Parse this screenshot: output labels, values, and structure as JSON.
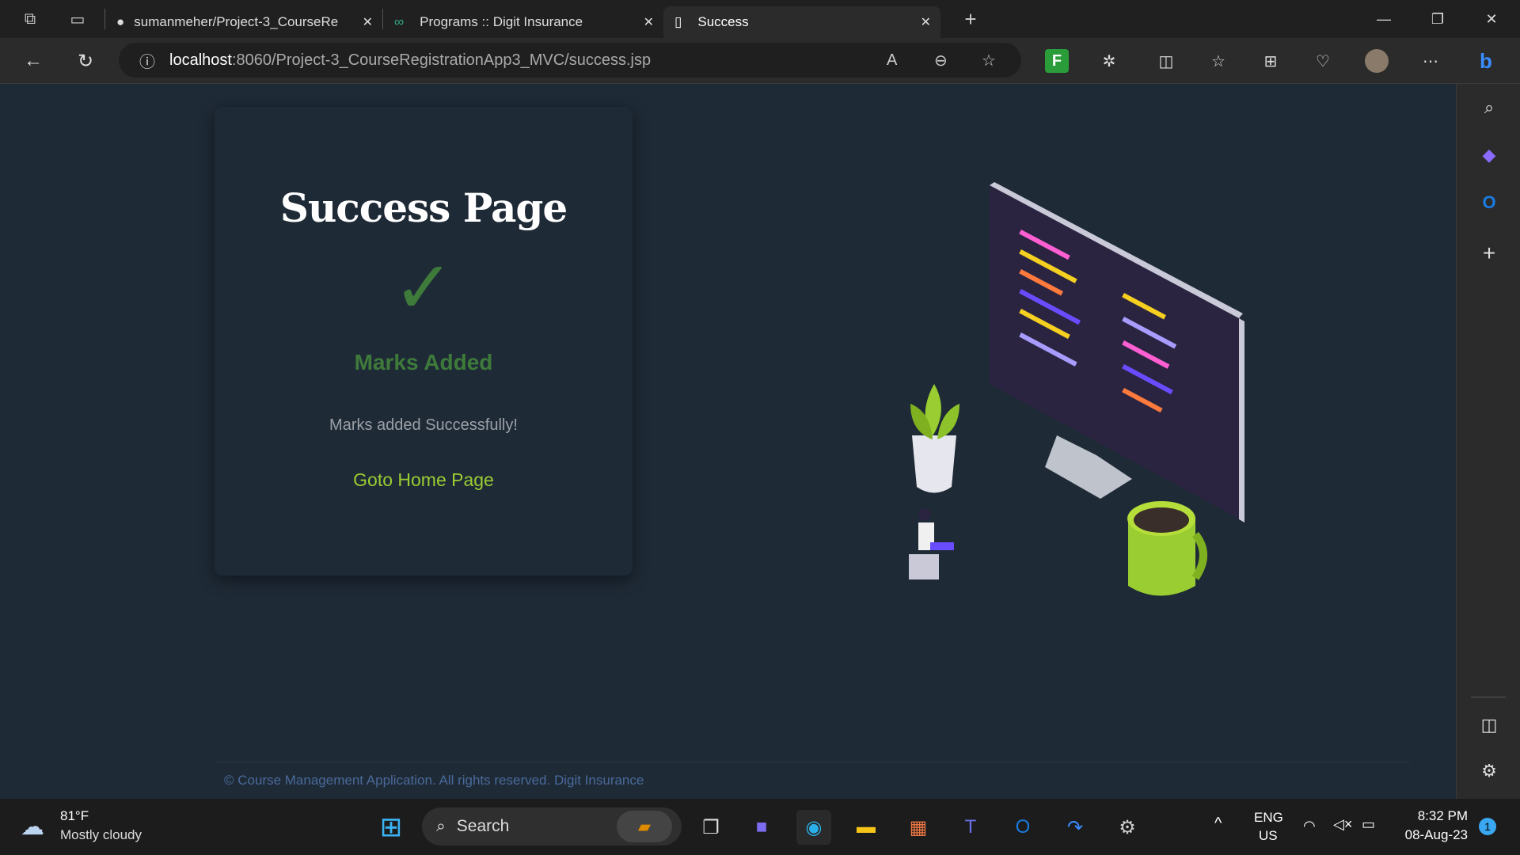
{
  "browser": {
    "tabs": [
      {
        "title": "sumanmeher/Project-3_CourseRe",
        "icon": "github-icon"
      },
      {
        "title": "Programs :: Digit Insurance",
        "icon": "link-icon"
      },
      {
        "title": "Success",
        "icon": "page-icon"
      }
    ],
    "url_host": "localhost",
    "url_path": ":8060/Project-3_CourseRegistrationApp3_MVC/success.jsp"
  },
  "card": {
    "title": "Success Page",
    "check": "✓",
    "status": "Marks Added",
    "message": "Marks added Successfully!",
    "link": "Goto Home Page"
  },
  "footer": "© Course Management Application. All rights reserved. Digit Insurance",
  "taskbar": {
    "weather_temp": "81°F",
    "weather_desc": "Mostly cloudy",
    "search": "Search",
    "lang1": "ENG",
    "lang2": "US",
    "time": "8:32 PM",
    "date": "08-Aug-23",
    "notifications": "1"
  },
  "colors": {
    "accent_green": "#3e7b3a",
    "link": "#9acd32",
    "bg": "#1e2a36"
  }
}
